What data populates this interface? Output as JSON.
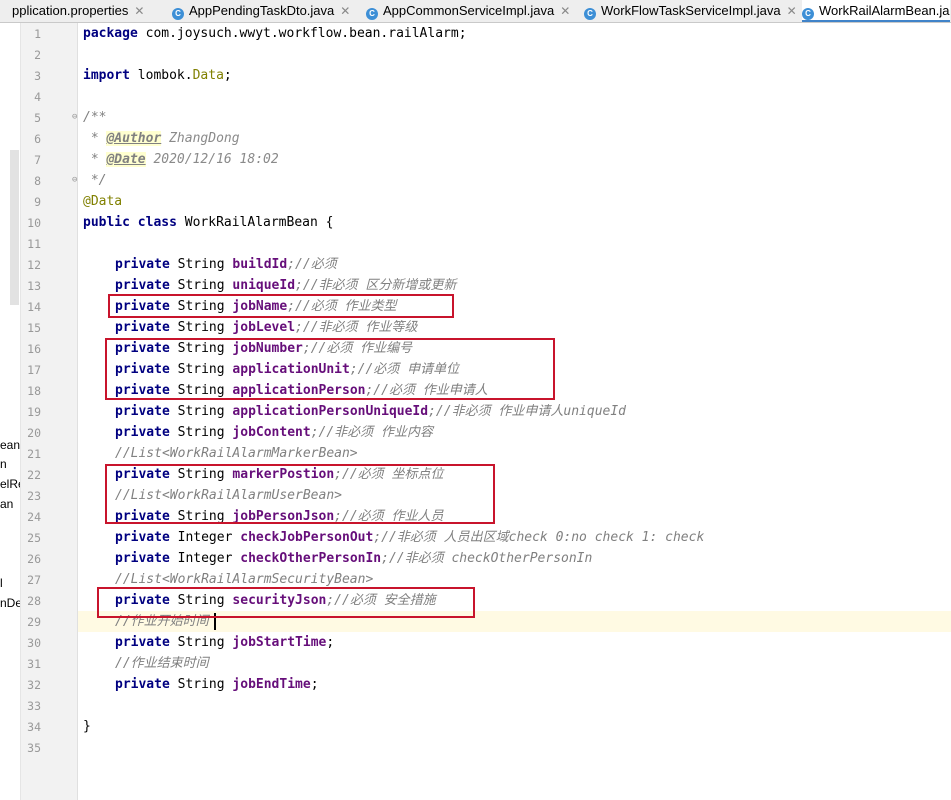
{
  "tabs": [
    {
      "label": "pplication.properties",
      "icon": "properties-icon",
      "active": false
    },
    {
      "label": "AppPendingTaskDto.java",
      "icon": "class-icon",
      "active": false
    },
    {
      "label": "AppCommonServiceImpl.java",
      "icon": "class-icon",
      "active": false
    },
    {
      "label": "WorkFlowTaskServiceImpl.java",
      "icon": "class-icon",
      "active": false
    },
    {
      "label": "WorkRailAlarmBean.ja",
      "icon": "class-icon",
      "active": true
    }
  ],
  "project_fragments": [
    "ean",
    "n",
    "elRe",
    "an",
    "l",
    "nDet"
  ],
  "line_numbers": [
    "1",
    "2",
    "3",
    "4",
    "5",
    "6",
    "7",
    "8",
    "9",
    "10",
    "11",
    "12",
    "13",
    "14",
    "15",
    "16",
    "17",
    "18",
    "19",
    "20",
    "21",
    "22",
    "23",
    "24",
    "25",
    "26",
    "27",
    "28",
    "29",
    "30",
    "31",
    "32",
    "33",
    "34",
    "35"
  ],
  "code": {
    "l1_kw": "package",
    "l1_rest": " com.joysuch.wwyt.workflow.bean.railAlarm;",
    "l3_kw": "import",
    "l3_pkg": " lombok.",
    "l3_cls": "Data",
    "l3_end": ";",
    "l5": "/**",
    "l6_pre": " * ",
    "l6_tag": "@Author",
    "l6_val": " ZhangDong",
    "l7_pre": " * ",
    "l7_tag": "@Date",
    "l7_val": " 2020/12/16 18:02",
    "l8": " */",
    "l9": "@Data",
    "l10_kw1": "public",
    "l10_kw2": "class",
    "l10_name": " WorkRailAlarmBean {",
    "private": "private",
    "String": " String ",
    "Integer": " Integer ",
    "f12": "buildId",
    "c12": ";//必须",
    "f13": "uniqueId",
    "c13": ";//非必须 区分新增或更新",
    "f14": "jobName",
    "c14": ";//必须 作业类型",
    "f15": "jobLevel",
    "c15": ";//非必须 作业等级",
    "f16": "jobNumber",
    "c16": ";//必须 作业编号",
    "f17": "applicationUnit",
    "c17": ";//必须 申请单位",
    "f18": "applicationPerson",
    "c18": ";//必须 作业申请人",
    "f19": "applicationPersonUniqueId",
    "c19": ";//非必须 作业申请人uniqueId",
    "f20": "jobContent",
    "c20": ";//非必须 作业内容",
    "l21": "//List<WorkRailAlarmMarkerBean>",
    "f22": "markerPostion",
    "c22": ";//必须 坐标点位",
    "l23": "//List<WorkRailAlarmUserBean>",
    "f24": "jobPersonJson",
    "c24": ";//必须 作业人员",
    "f25": "checkJobPersonOut",
    "c25": ";//非必须 人员出区域check 0:no check 1: check",
    "f26": "checkOtherPersonIn",
    "c26": ";//非必须 checkOtherPersonIn",
    "l27": "//List<WorkRailAlarmSecurityBean>",
    "f28": "securityJson",
    "c28": ";//必须 安全措施",
    "l29": "//作业开始时间",
    "f30": "jobStartTime",
    "c30": ";",
    "l31": "//作业结束时间",
    "f32": "jobEndTime",
    "c32": ";",
    "l34": "}"
  },
  "colors": {
    "keyword": "#000080",
    "field": "#660e7a",
    "comment": "#808080",
    "annotation": "#808000",
    "highlight_box": "#c8142c",
    "current_line": "#fffae3"
  }
}
